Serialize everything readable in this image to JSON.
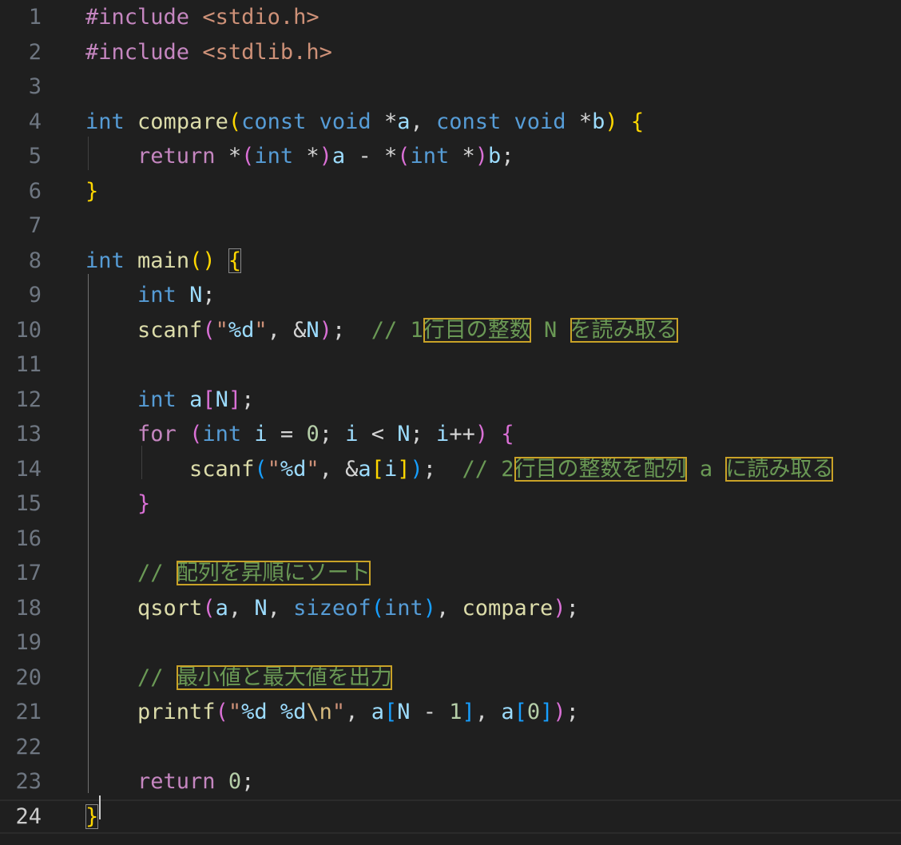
{
  "lines": [
    {
      "n": "1",
      "tokens": [
        [
          "t-dir",
          "#include"
        ],
        [
          "t-plain",
          " "
        ],
        [
          "t-inc",
          "<stdio.h>"
        ]
      ]
    },
    {
      "n": "2",
      "tokens": [
        [
          "t-dir",
          "#include"
        ],
        [
          "t-plain",
          " "
        ],
        [
          "t-inc",
          "<stdlib.h>"
        ]
      ]
    },
    {
      "n": "3",
      "tokens": []
    },
    {
      "n": "4",
      "tokens": [
        [
          "t-type",
          "int"
        ],
        [
          "t-plain",
          " "
        ],
        [
          "t-fn",
          "compare"
        ],
        [
          "t-p1",
          "("
        ],
        [
          "t-type",
          "const"
        ],
        [
          "t-plain",
          " "
        ],
        [
          "t-type",
          "void"
        ],
        [
          "t-plain",
          " *"
        ],
        [
          "t-var",
          "a"
        ],
        [
          "t-plain",
          ", "
        ],
        [
          "t-type",
          "const"
        ],
        [
          "t-plain",
          " "
        ],
        [
          "t-type",
          "void"
        ],
        [
          "t-plain",
          " *"
        ],
        [
          "t-var",
          "b"
        ],
        [
          "t-p1",
          ")"
        ],
        [
          "t-plain",
          " "
        ],
        [
          "t-p1",
          "{"
        ]
      ]
    },
    {
      "n": "5",
      "tokens": [
        [
          "t-plain",
          "    "
        ],
        [
          "t-ctl",
          "return"
        ],
        [
          "t-plain",
          " *"
        ],
        [
          "t-p2",
          "("
        ],
        [
          "t-type",
          "int"
        ],
        [
          "t-plain",
          " *"
        ],
        [
          "t-p2",
          ")"
        ],
        [
          "t-var",
          "a"
        ],
        [
          "t-plain",
          " - *"
        ],
        [
          "t-p2",
          "("
        ],
        [
          "t-type",
          "int"
        ],
        [
          "t-plain",
          " *"
        ],
        [
          "t-p2",
          ")"
        ],
        [
          "t-var",
          "b"
        ],
        [
          "t-plain",
          ";"
        ]
      ]
    },
    {
      "n": "6",
      "tokens": [
        [
          "t-p1",
          "}"
        ]
      ]
    },
    {
      "n": "7",
      "tokens": []
    },
    {
      "n": "8",
      "tokens": [
        [
          "t-type",
          "int"
        ],
        [
          "t-plain",
          " "
        ],
        [
          "t-fn",
          "main"
        ],
        [
          "t-p1",
          "()"
        ],
        [
          "t-plain",
          " "
        ],
        [
          "t-p1",
          "{",
          "box"
        ]
      ]
    },
    {
      "n": "9",
      "tokens": [
        [
          "t-plain",
          "    "
        ],
        [
          "t-type",
          "int"
        ],
        [
          "t-plain",
          " "
        ],
        [
          "t-var",
          "N"
        ],
        [
          "t-plain",
          ";"
        ]
      ]
    },
    {
      "n": "10",
      "tokens": [
        [
          "t-plain",
          "    "
        ],
        [
          "t-fn",
          "scanf"
        ],
        [
          "t-p2",
          "("
        ],
        [
          "t-str",
          "\""
        ],
        [
          "t-fmt",
          "%d"
        ],
        [
          "t-str",
          "\""
        ],
        [
          "t-plain",
          ", &"
        ],
        [
          "t-var",
          "N"
        ],
        [
          "t-p2",
          ")"
        ],
        [
          "t-plain",
          ";  "
        ],
        [
          "t-cmt",
          "// 1"
        ],
        [
          "t-cmt",
          "行目の整数",
          "hl"
        ],
        [
          "t-cmt",
          " N "
        ],
        [
          "t-cmt",
          "を読み取る",
          "hl"
        ]
      ]
    },
    {
      "n": "11",
      "tokens": []
    },
    {
      "n": "12",
      "tokens": [
        [
          "t-plain",
          "    "
        ],
        [
          "t-type",
          "int"
        ],
        [
          "t-plain",
          " "
        ],
        [
          "t-var",
          "a"
        ],
        [
          "t-p2",
          "["
        ],
        [
          "t-var",
          "N"
        ],
        [
          "t-p2",
          "]"
        ],
        [
          "t-plain",
          ";"
        ]
      ]
    },
    {
      "n": "13",
      "tokens": [
        [
          "t-plain",
          "    "
        ],
        [
          "t-ctl",
          "for"
        ],
        [
          "t-plain",
          " "
        ],
        [
          "t-p2",
          "("
        ],
        [
          "t-type",
          "int"
        ],
        [
          "t-plain",
          " "
        ],
        [
          "t-var",
          "i"
        ],
        [
          "t-plain",
          " = "
        ],
        [
          "t-num",
          "0"
        ],
        [
          "t-plain",
          "; "
        ],
        [
          "t-var",
          "i"
        ],
        [
          "t-plain",
          " < "
        ],
        [
          "t-var",
          "N"
        ],
        [
          "t-plain",
          "; "
        ],
        [
          "t-var",
          "i"
        ],
        [
          "t-plain",
          "++"
        ],
        [
          "t-p2",
          ")"
        ],
        [
          "t-plain",
          " "
        ],
        [
          "t-p2",
          "{"
        ]
      ]
    },
    {
      "n": "14",
      "tokens": [
        [
          "t-plain",
          "        "
        ],
        [
          "t-fn",
          "scanf"
        ],
        [
          "t-p3",
          "("
        ],
        [
          "t-str",
          "\""
        ],
        [
          "t-fmt",
          "%d"
        ],
        [
          "t-str",
          "\""
        ],
        [
          "t-plain",
          ", &"
        ],
        [
          "t-var",
          "a"
        ],
        [
          "t-p1",
          "["
        ],
        [
          "t-var",
          "i"
        ],
        [
          "t-p1",
          "]"
        ],
        [
          "t-p3",
          ")"
        ],
        [
          "t-plain",
          ";  "
        ],
        [
          "t-cmt",
          "// 2"
        ],
        [
          "t-cmt",
          "行目の整数を配列",
          "hl"
        ],
        [
          "t-cmt",
          " a "
        ],
        [
          "t-cmt",
          "に読み取る",
          "hl"
        ]
      ]
    },
    {
      "n": "15",
      "tokens": [
        [
          "t-plain",
          "    "
        ],
        [
          "t-p2",
          "}"
        ]
      ]
    },
    {
      "n": "16",
      "tokens": []
    },
    {
      "n": "17",
      "tokens": [
        [
          "t-plain",
          "    "
        ],
        [
          "t-cmt",
          "// "
        ],
        [
          "t-cmt",
          "配列を昇順にソート",
          "hl"
        ]
      ]
    },
    {
      "n": "18",
      "tokens": [
        [
          "t-plain",
          "    "
        ],
        [
          "t-fn",
          "qsort"
        ],
        [
          "t-p2",
          "("
        ],
        [
          "t-var",
          "a"
        ],
        [
          "t-plain",
          ", "
        ],
        [
          "t-var",
          "N"
        ],
        [
          "t-plain",
          ", "
        ],
        [
          "t-type",
          "sizeof"
        ],
        [
          "t-p3",
          "("
        ],
        [
          "t-type",
          "int"
        ],
        [
          "t-p3",
          ")"
        ],
        [
          "t-plain",
          ", "
        ],
        [
          "t-fn",
          "compare"
        ],
        [
          "t-p2",
          ")"
        ],
        [
          "t-plain",
          ";"
        ]
      ]
    },
    {
      "n": "19",
      "tokens": []
    },
    {
      "n": "20",
      "tokens": [
        [
          "t-plain",
          "    "
        ],
        [
          "t-cmt",
          "// "
        ],
        [
          "t-cmt",
          "最小値と最大値を出力",
          "hl"
        ]
      ]
    },
    {
      "n": "21",
      "tokens": [
        [
          "t-plain",
          "    "
        ],
        [
          "t-fn",
          "printf"
        ],
        [
          "t-p2",
          "("
        ],
        [
          "t-str",
          "\""
        ],
        [
          "t-fmt",
          "%d"
        ],
        [
          "t-str",
          " "
        ],
        [
          "t-fmt",
          "%d"
        ],
        [
          "t-esc",
          "\\n"
        ],
        [
          "t-str",
          "\""
        ],
        [
          "t-plain",
          ", "
        ],
        [
          "t-var",
          "a"
        ],
        [
          "t-p3",
          "["
        ],
        [
          "t-var",
          "N"
        ],
        [
          "t-plain",
          " - "
        ],
        [
          "t-num",
          "1"
        ],
        [
          "t-p3",
          "]"
        ],
        [
          "t-plain",
          ", "
        ],
        [
          "t-var",
          "a"
        ],
        [
          "t-p3",
          "["
        ],
        [
          "t-num",
          "0"
        ],
        [
          "t-p3",
          "]"
        ],
        [
          "t-p2",
          ")"
        ],
        [
          "t-plain",
          ";"
        ]
      ]
    },
    {
      "n": "22",
      "tokens": []
    },
    {
      "n": "23",
      "tokens": [
        [
          "t-plain",
          "    "
        ],
        [
          "t-ctl",
          "return"
        ],
        [
          "t-plain",
          " "
        ],
        [
          "t-num",
          "0"
        ],
        [
          "t-plain",
          ";"
        ]
      ]
    },
    {
      "n": "24",
      "tokens": [
        [
          "t-p1",
          "}",
          "box"
        ]
      ]
    }
  ],
  "current_line": "24",
  "colors": {
    "background": "#1f1f1f",
    "highlight_border": "#c9a227",
    "keyword": "#569cd6",
    "function": "#dcdcaa",
    "comment": "#6a9955"
  }
}
